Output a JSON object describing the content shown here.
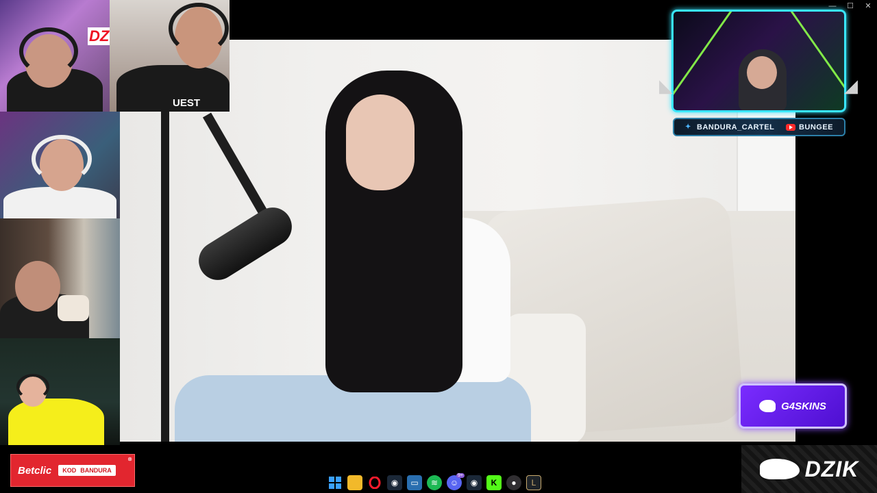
{
  "window": {
    "controls": [
      "—",
      "☐",
      "✕"
    ]
  },
  "streamer": {
    "twitter_label": "BANDURA_CARTEL",
    "youtube_label": "BUNGEE"
  },
  "sponsors": {
    "g4skins": "G4SKINS",
    "betclic_brand": "Betclic",
    "betclic_code_prefix": "KOD",
    "betclic_code": "BANDURA",
    "dzik": "DZIK"
  },
  "cams": {
    "cam1_logo": "DZ",
    "cam2_shirt": "UEST"
  },
  "taskbar": {
    "icons": [
      "windows",
      "file-explorer",
      "opera",
      "steam",
      "monitor",
      "spotify",
      "discord",
      "steam-2",
      "kick",
      "obs",
      "league"
    ],
    "discord_badge": "9+"
  },
  "colors": {
    "accent_cyan": "#39e6ff",
    "g4_purple": "#7a2cff",
    "betclic_red": "#e2262f"
  }
}
